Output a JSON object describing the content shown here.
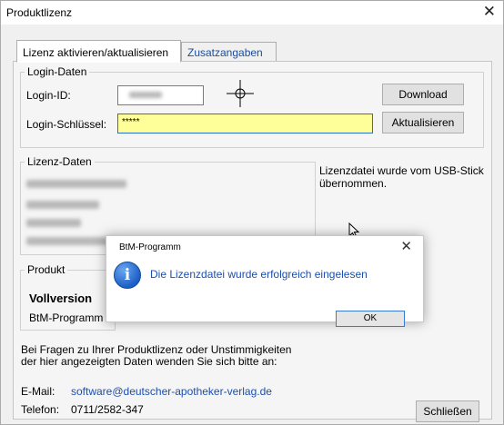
{
  "window": {
    "title": "Produktlizenz"
  },
  "tabs": [
    {
      "label": "Lizenz aktivieren/aktualisieren"
    },
    {
      "label": "Zusatzangaben"
    }
  ],
  "login": {
    "group_label": "Login-Daten",
    "id_label": "Login-ID:",
    "key_label": "Login-Schlüssel:",
    "key_value": "*****",
    "download_button": "Download",
    "update_button": "Aktualisieren"
  },
  "license": {
    "group_label": "Lizenz-Daten",
    "status_line1": "Lizenzdatei wurde vom USB-Stick",
    "status_line2": "übernommen."
  },
  "product": {
    "group_label": "Produkt",
    "version": "Vollversion",
    "name": "BtM-Programm"
  },
  "dialog": {
    "title": "BtM-Programm",
    "message": "Die Lizenzdatei wurde erfolgreich eingelesen",
    "ok_button": "OK"
  },
  "footer": {
    "help_line1": "Bei Fragen zu Ihrer Produktlizenz oder Unstimmigkeiten",
    "help_line2": "der hier angezeigten Daten wenden Sie sich bitte an:",
    "email_label": "E-Mail:",
    "email_value": "software@deutscher-apotheker-verlag.de",
    "phone_label": "Telefon:",
    "phone_value": "0711/2582-347",
    "close_button": "Schließen"
  }
}
